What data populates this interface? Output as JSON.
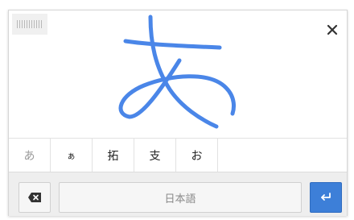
{
  "candidates": [
    {
      "label": "あ"
    },
    {
      "label": "ぁ"
    },
    {
      "label": "拓"
    },
    {
      "label": "支"
    },
    {
      "label": "お"
    }
  ],
  "bottom_bar": {
    "language_label": "日本語"
  },
  "icons": {
    "close": "close-icon",
    "backspace": "backspace-icon",
    "enter": "enter-icon",
    "drag": "drag-handle-icon"
  },
  "colors": {
    "ink": "#4a86e8",
    "enter_button": "#3d7fd8",
    "first_candidate": "#9a9a9a"
  }
}
